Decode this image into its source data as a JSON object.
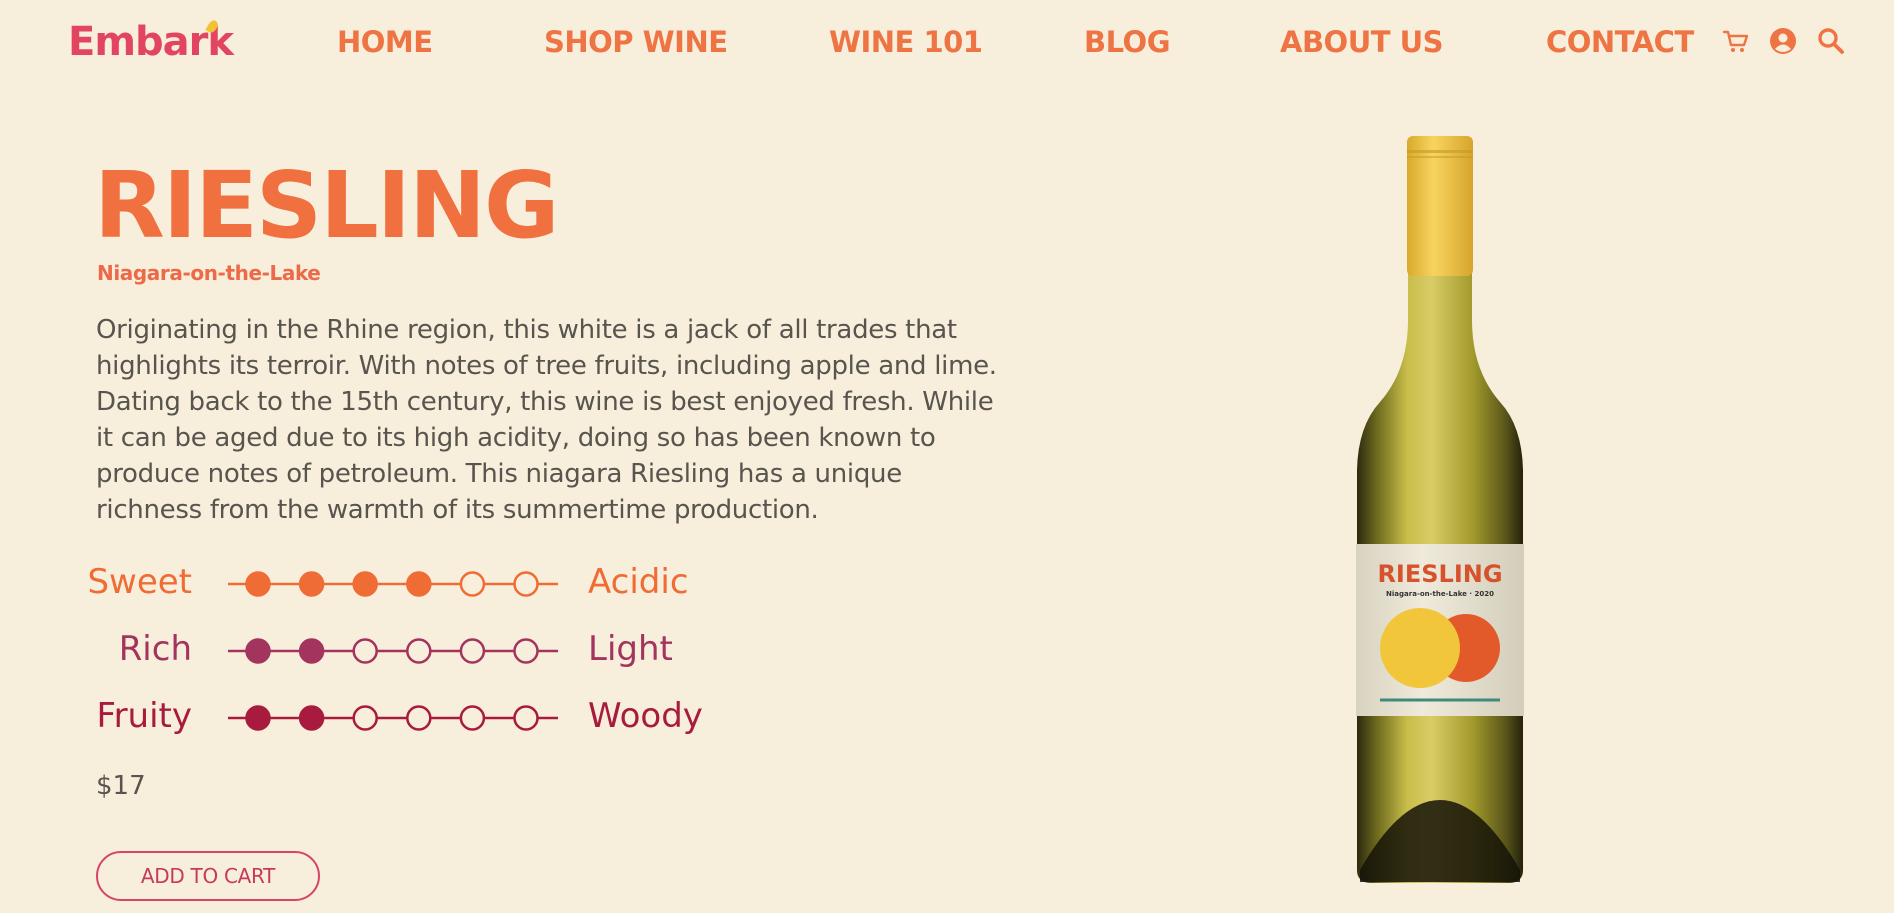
{
  "header": {
    "logo": "Embark",
    "nav": [
      {
        "label": "HOME"
      },
      {
        "label": "SHOP WINE"
      },
      {
        "label": "WINE 101"
      },
      {
        "label": "BLOG"
      },
      {
        "label": "ABOUT US"
      },
      {
        "label": "CONTACT"
      }
    ],
    "icons": [
      "cart-icon",
      "user-icon",
      "search-icon"
    ]
  },
  "product": {
    "name": "RIESLING",
    "region": "Niagara-on-the-Lake",
    "description": "Originating in the Rhine region, this white is a jack of all trades that highlights its terroir. With notes of tree fruits, including apple and lime. Dating back to the 15th century, this wine is best enjoyed fresh. While it can be aged due to its high acidity, doing so has been known to produce notes of petroleum. This niagara Riesling has a unique richness from the warmth of its summertime production.",
    "scales": [
      {
        "left": "Sweet",
        "right": "Acidic",
        "filled": 4,
        "total": 6,
        "color": "#ef6c35"
      },
      {
        "left": "Rich",
        "right": "Light",
        "filled": 2,
        "total": 6,
        "color": "#a3345e"
      },
      {
        "left": "Fruity",
        "right": "Woody",
        "filled": 2,
        "total": 6,
        "color": "#a81b3e"
      }
    ],
    "price": "$17",
    "add_to_cart": "ADD TO CART",
    "label": {
      "name": "RIESLING",
      "subtitle": "Niagara-on-the-Lake · 2020"
    }
  },
  "colors": {
    "background": "#f8eedc",
    "accent": "#ee7443",
    "logo": "#e2455f"
  }
}
